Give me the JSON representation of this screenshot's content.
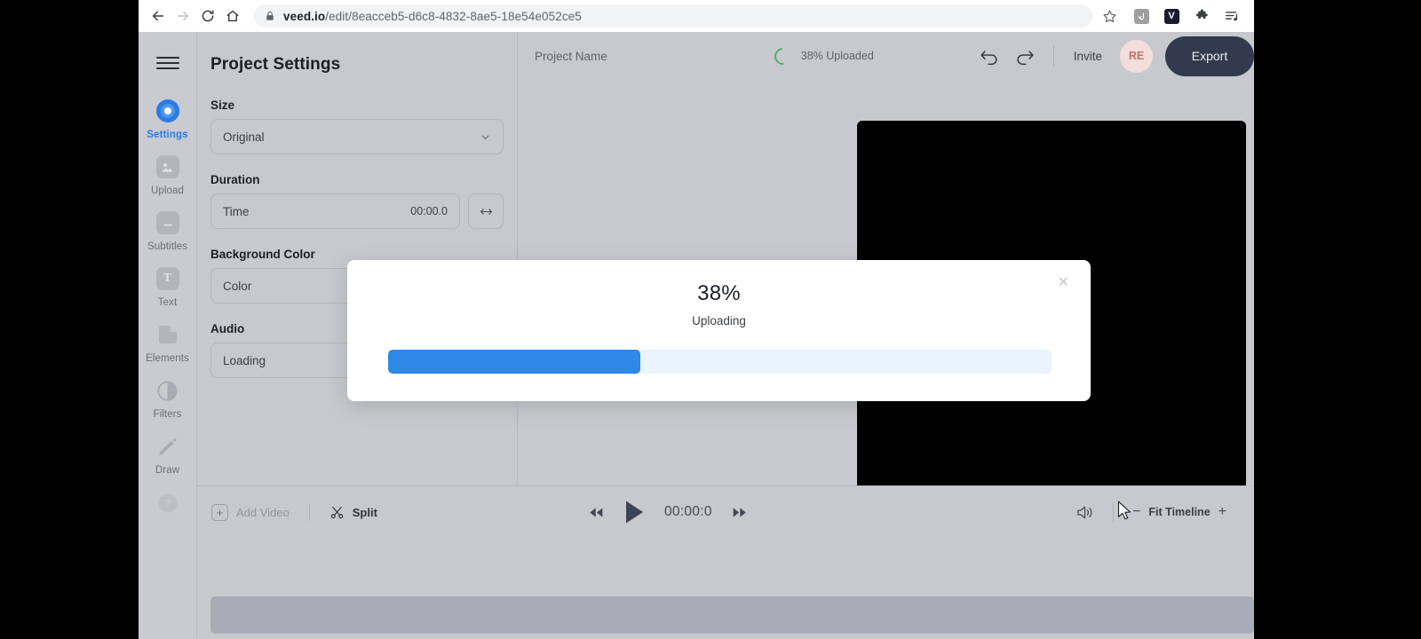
{
  "browser": {
    "back_label": "Back",
    "forward_label": "Forward",
    "reload_label": "Reload",
    "home_label": "Home",
    "url_domain": "veed.io",
    "url_path": "/edit/8eacceb5-d6c8-4832-8ae5-18e54e052ce5",
    "bookmark_icon": "star-icon",
    "extensions": [
      {
        "name": "extension-icon-1",
        "label": "⤵",
        "bg": "#9e9e9e"
      },
      {
        "name": "extension-icon-veed",
        "label": "V",
        "bg": "#1b1b2f"
      }
    ],
    "puzzle_icon": "puzzle-icon",
    "menu_icon": "browser-menu-icon"
  },
  "rail": {
    "menu_icon": "hamburger-icon",
    "items": [
      {
        "label": "Settings",
        "icon": "settings-target-icon",
        "active": true
      },
      {
        "label": "Upload",
        "icon": "upload-image-icon",
        "active": false
      },
      {
        "label": "Subtitles",
        "icon": "subtitles-icon",
        "active": false
      },
      {
        "label": "Text",
        "icon": "text-t-icon",
        "active": false
      },
      {
        "label": "Elements",
        "icon": "elements-shape-icon",
        "active": false
      },
      {
        "label": "Filters",
        "icon": "filters-contrast-icon",
        "active": false
      },
      {
        "label": "Draw",
        "icon": "draw-pencil-icon",
        "active": false
      }
    ],
    "help_icon": "help-question-icon"
  },
  "panel": {
    "title": "Project Settings",
    "fields": [
      {
        "label": "Size",
        "value": "Original",
        "control": "dropdown",
        "trailing_icon": "chevron-down-icon"
      },
      {
        "label": "Duration",
        "value": "Time",
        "secondary": "00:00.0",
        "control": "time-input",
        "side_button_icon": "resize-horizontal-icon"
      },
      {
        "label": "Background Color",
        "value": "Color",
        "control": "color-picker"
      },
      {
        "label": "Audio",
        "value": "Loading",
        "control": "audio-select"
      }
    ]
  },
  "topbar": {
    "project_name": "Project Name",
    "upload_status": "38% Uploaded",
    "spinner_color": "#49b26a",
    "undo_icon": "undo-arrow-icon",
    "redo_icon": "redo-arrow-icon",
    "invite_label": "Invite",
    "avatar_initials": "RE",
    "avatar_bg": "#f3dedc",
    "export_label": "Export",
    "export_bg": "#343a4d"
  },
  "timeline": {
    "add_video_label": "Add Video",
    "add_video_icon": "plus-box-icon",
    "split_label": "Split",
    "split_icon": "scissors-icon",
    "skip_back_icon": "skip-back-icon",
    "play_icon": "play-icon",
    "skip_forward_icon": "skip-forward-icon",
    "current_time": "00:00:0",
    "volume_icon": "volume-icon",
    "zoom_out_label": "−",
    "fit_label": "Fit Timeline",
    "zoom_in_label": "+"
  },
  "modal": {
    "percent": "38%",
    "status": "Uploading",
    "close_icon": "close-icon",
    "progress_value": 38,
    "progress_fill_color": "#2e88e5",
    "progress_track_color": "#eaf4fe"
  }
}
